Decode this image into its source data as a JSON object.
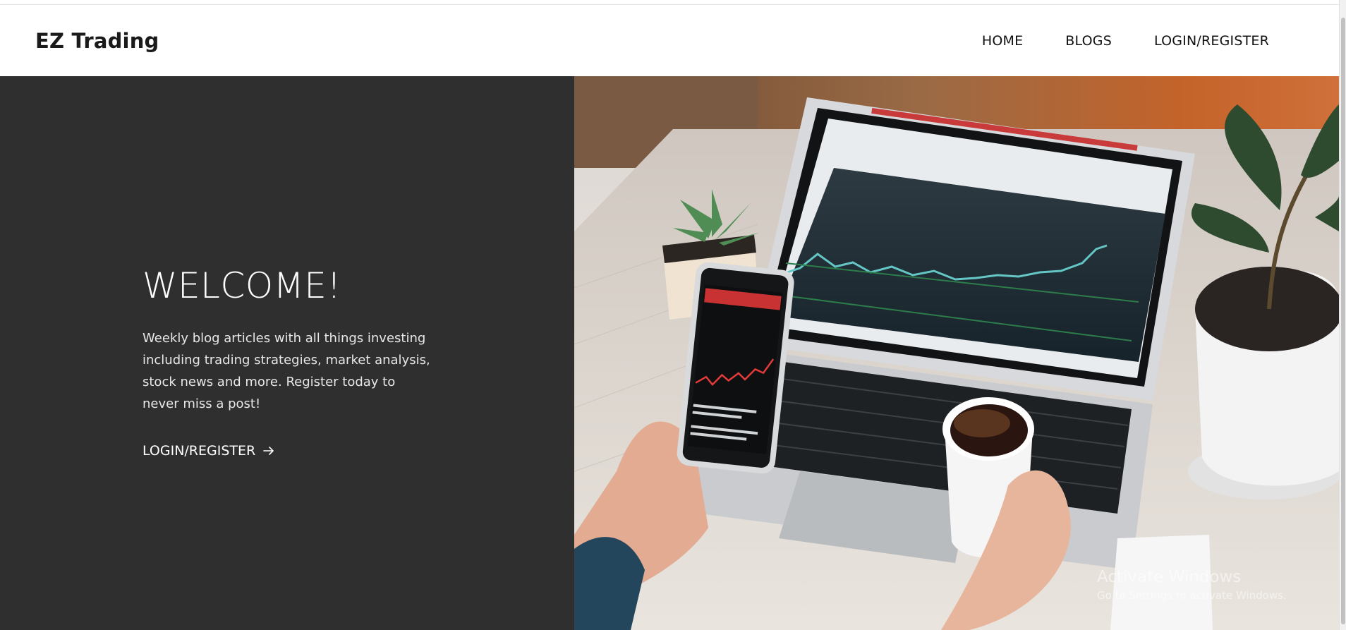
{
  "brand": {
    "name": "EZ Trading"
  },
  "nav": {
    "items": [
      {
        "label": "HOME"
      },
      {
        "label": "BLOGS"
      },
      {
        "label": "LOGIN/REGISTER"
      }
    ]
  },
  "hero": {
    "title": "WELCOME!",
    "description": "Weekly blog articles with all things investing including trading strategies, market analysis, stock news and more. Register today to never miss a post!",
    "cta_label": "LOGIN/REGISTER",
    "cta_icon": "arrow-right-icon",
    "image_icon": "laptop-phone-coffee-photo"
  },
  "watermark": {
    "title": "Activate Windows",
    "subtitle": "Go to Settings to activate Windows."
  },
  "colors": {
    "hero_dark": "#2f2f2f",
    "header_bg": "#ffffff",
    "text_dark": "#111111"
  }
}
